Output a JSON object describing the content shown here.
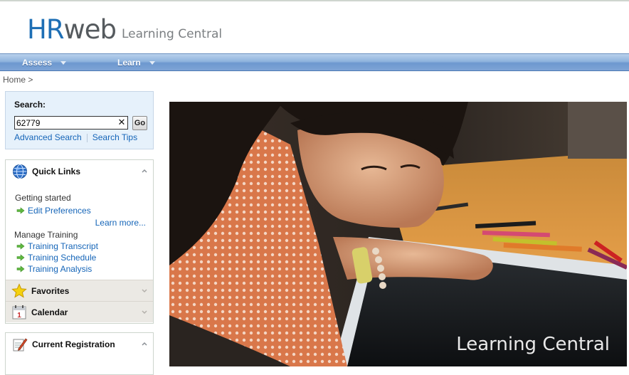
{
  "header": {
    "logo_hr": "HR",
    "logo_web": "web",
    "subtitle": "Learning Central"
  },
  "nav": {
    "items": [
      {
        "label": "Assess"
      },
      {
        "label": "Learn"
      }
    ]
  },
  "breadcrumb": "Home >",
  "search": {
    "label": "Search:",
    "value": "62779",
    "go_label": "Go",
    "advanced_label": "Advanced Search",
    "tips_label": "Search Tips"
  },
  "quick_links": {
    "title": "Quick Links",
    "groups": [
      {
        "heading": "Getting started",
        "links": [
          "Edit Preferences"
        ],
        "more": "Learn more..."
      },
      {
        "heading": "Manage Training",
        "links": [
          "Training Transcript",
          "Training Schedule",
          "Training Analysis"
        ]
      }
    ]
  },
  "favorites": {
    "title": "Favorites"
  },
  "calendar": {
    "title": "Calendar",
    "day": "1"
  },
  "current_registration": {
    "title": "Current Registration"
  },
  "hero": {
    "caption": "Learning Central"
  },
  "colors": {
    "brand_blue": "#1e6fb5",
    "link": "#1565b8",
    "nav_bar": "#7ea4d6",
    "search_bg": "#e6f1fb"
  }
}
